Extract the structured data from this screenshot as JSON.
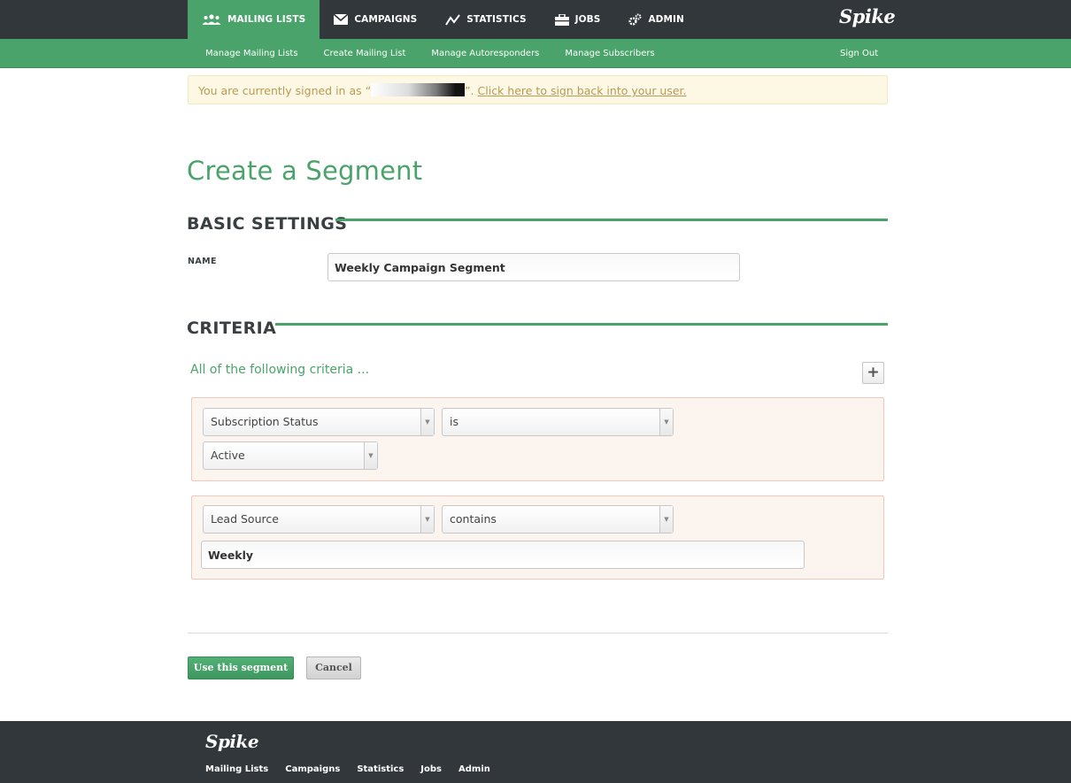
{
  "nav": {
    "items": [
      {
        "label": "MAILING LISTS",
        "icon": "users-icon",
        "active": true
      },
      {
        "label": "CAMPAIGNS",
        "icon": "envelope-icon",
        "active": false
      },
      {
        "label": "STATISTICS",
        "icon": "chart-line-icon",
        "active": false
      },
      {
        "label": "JOBS",
        "icon": "briefcase-icon",
        "active": false
      },
      {
        "label": "ADMIN",
        "icon": "gears-icon",
        "active": false
      }
    ],
    "logo": "Spike"
  },
  "subnav": {
    "items": [
      "Manage Mailing Lists",
      "Create Mailing List",
      "Manage Autoresponders",
      "Manage Subscribers"
    ],
    "sign_out": "Sign Out"
  },
  "notice": {
    "prefix": "You are currently signed in as “",
    "suffix": "”. ",
    "link": "Click here to sign back into your user."
  },
  "page": {
    "title": "Create a Segment"
  },
  "basic_settings": {
    "title": "BASIC SETTINGS",
    "name_label": "NAME",
    "name_value": "Weekly Campaign Segment"
  },
  "criteria": {
    "title": "CRITERIA",
    "intro": "All of the following criteria ...",
    "add_symbol": "+",
    "rules": [
      {
        "field": "Subscription Status",
        "operator": "is",
        "value": "Active",
        "value_type": "select"
      },
      {
        "field": "Lead Source",
        "operator": "contains",
        "value": "Weekly",
        "value_type": "text"
      }
    ]
  },
  "actions": {
    "submit": "Use this segment",
    "cancel": "Cancel"
  },
  "footer": {
    "logo": "Spike",
    "links": [
      "Mailing Lists",
      "Campaigns",
      "Statistics",
      "Jobs",
      "Admin"
    ]
  },
  "colors": {
    "brand_green": "#4aa36a",
    "dark_bar": "#32373b",
    "notice_bg": "#fdf8e4",
    "criteria_bg": "#fcf4ef"
  }
}
